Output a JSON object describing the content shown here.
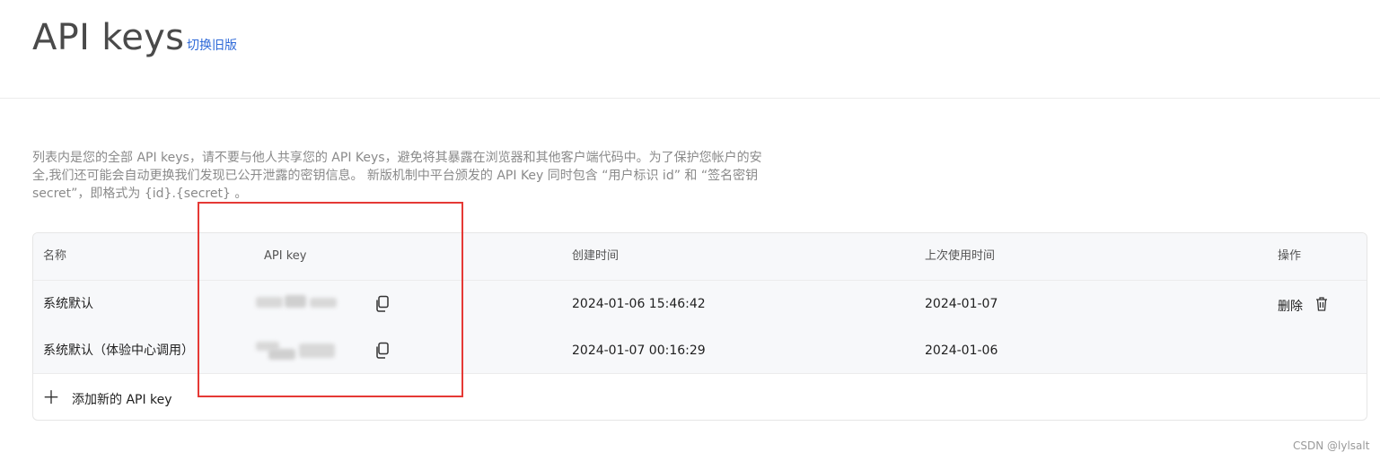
{
  "header": {
    "title": "API keys",
    "switch_label": "切换旧版"
  },
  "description": "列表内是您的全部 API keys，请不要与他人共享您的 API Keys，避免将其暴露在浏览器和其他客户端代码中。为了保护您帐户的安全,我们还可能会自动更换我们发现已公开泄露的密钥信息。 新版机制中平台颁发的 API Key 同时包含 “用户标识 id” 和 “签名密钥 secret”，即格式为 {id}.{secret} 。",
  "table": {
    "columns": [
      "名称",
      "API key",
      "创建时间",
      "上次使用时间",
      "操作"
    ],
    "rows": [
      {
        "name": "系统默认",
        "created": "2024-01-06 15:46:42",
        "last_used": "2024-01-07",
        "action": "删除"
      },
      {
        "name": "系统默认（体验中心调用）",
        "created": "2024-01-07 00:16:29",
        "last_used": "2024-01-06",
        "action": ""
      }
    ],
    "add_label": "添加新的 API key"
  },
  "icons": {
    "copy": "copy-icon",
    "trash": "trash-icon",
    "plus": "plus-icon"
  },
  "colors": {
    "link": "#2f6ad8",
    "annotation_box": "#e53935"
  },
  "watermark": "CSDN @lylsalt"
}
